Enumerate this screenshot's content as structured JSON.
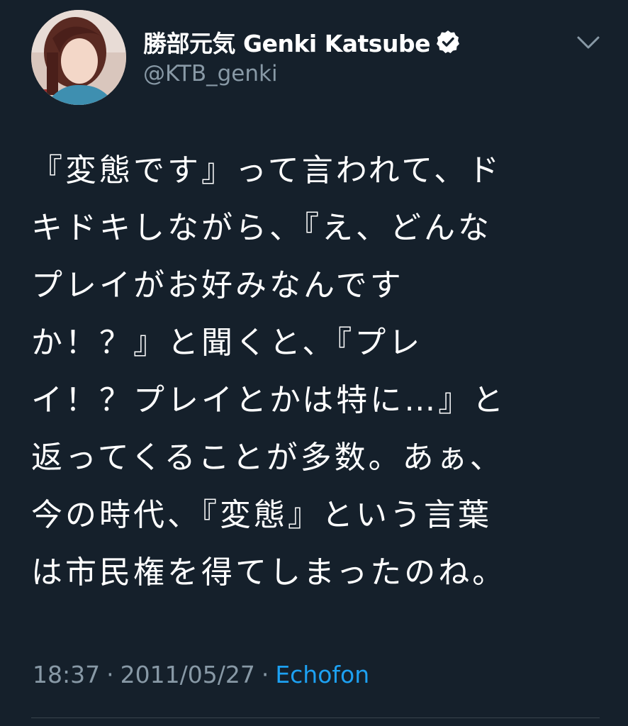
{
  "user": {
    "display_name": "勝部元気 Genki Katsube",
    "handle": "@KTB_genki",
    "verified": true
  },
  "tweet": {
    "lines": [
      "『変態です』って言われて、ド",
      "キドキしながら、『え、どんな",
      "プレイがお好みなんです",
      "か！？』と聞くと、『プレ",
      "イ！？プレイとかは特に…』と",
      "返ってくることが多数。あぁ、",
      "今の時代、『変態』という言葉",
      "は市民権を得てしまったのね。"
    ]
  },
  "meta": {
    "time": "18:37",
    "dot1": "·",
    "date": "2011/05/27",
    "dot2": "·",
    "source": "Echofon"
  },
  "icons": {
    "verified": "verified-badge-icon",
    "menu": "chevron-down-icon"
  },
  "colors": {
    "background": "#15202b",
    "text": "#ffffff",
    "secondary": "#8899a6",
    "link": "#1da1f2"
  }
}
